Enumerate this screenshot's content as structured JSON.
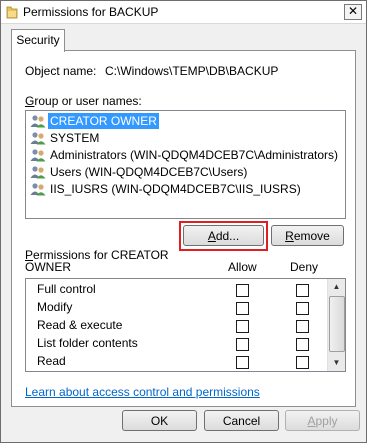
{
  "window": {
    "title": "Permissions for BACKUP",
    "close_glyph": "✕"
  },
  "tabs": [
    {
      "label": "Security"
    }
  ],
  "object": {
    "label": "Object name:",
    "value": "C:\\Windows\\TEMP\\DB\\BACKUP"
  },
  "group_users": {
    "label": "Group or user names:",
    "items": [
      {
        "name": "CREATOR OWNER",
        "icon": "users-icon",
        "selected": true
      },
      {
        "name": "SYSTEM",
        "icon": "users-icon",
        "selected": false
      },
      {
        "name": "Administrators (WIN-QDQM4DCEB7C\\Administrators)",
        "icon": "users-icon",
        "selected": false
      },
      {
        "name": "Users (WIN-QDQM4DCEB7C\\Users)",
        "icon": "users-icon",
        "selected": false
      },
      {
        "name": "IIS_IUSRS (WIN-QDQM4DCEB7C\\IIS_IUSRS)",
        "icon": "users-icon",
        "selected": false
      }
    ]
  },
  "buttons": {
    "add": "Add...",
    "remove": "Remove",
    "ok": "OK",
    "cancel": "Cancel",
    "apply": "Apply"
  },
  "permissions": {
    "label_line1": "Permissions for CREATOR",
    "label_line2": "OWNER",
    "allow_header": "Allow",
    "deny_header": "Deny",
    "rows": [
      {
        "name": "Full control",
        "allow": false,
        "deny": false
      },
      {
        "name": "Modify",
        "allow": false,
        "deny": false
      },
      {
        "name": "Read & execute",
        "allow": false,
        "deny": false
      },
      {
        "name": "List folder contents",
        "allow": false,
        "deny": false
      },
      {
        "name": "Read",
        "allow": false,
        "deny": false
      }
    ]
  },
  "link": "Learn about access control and permissions",
  "colors": {
    "selection": "#3399ff",
    "highlight": "#e02020",
    "link": "#0066cc"
  }
}
